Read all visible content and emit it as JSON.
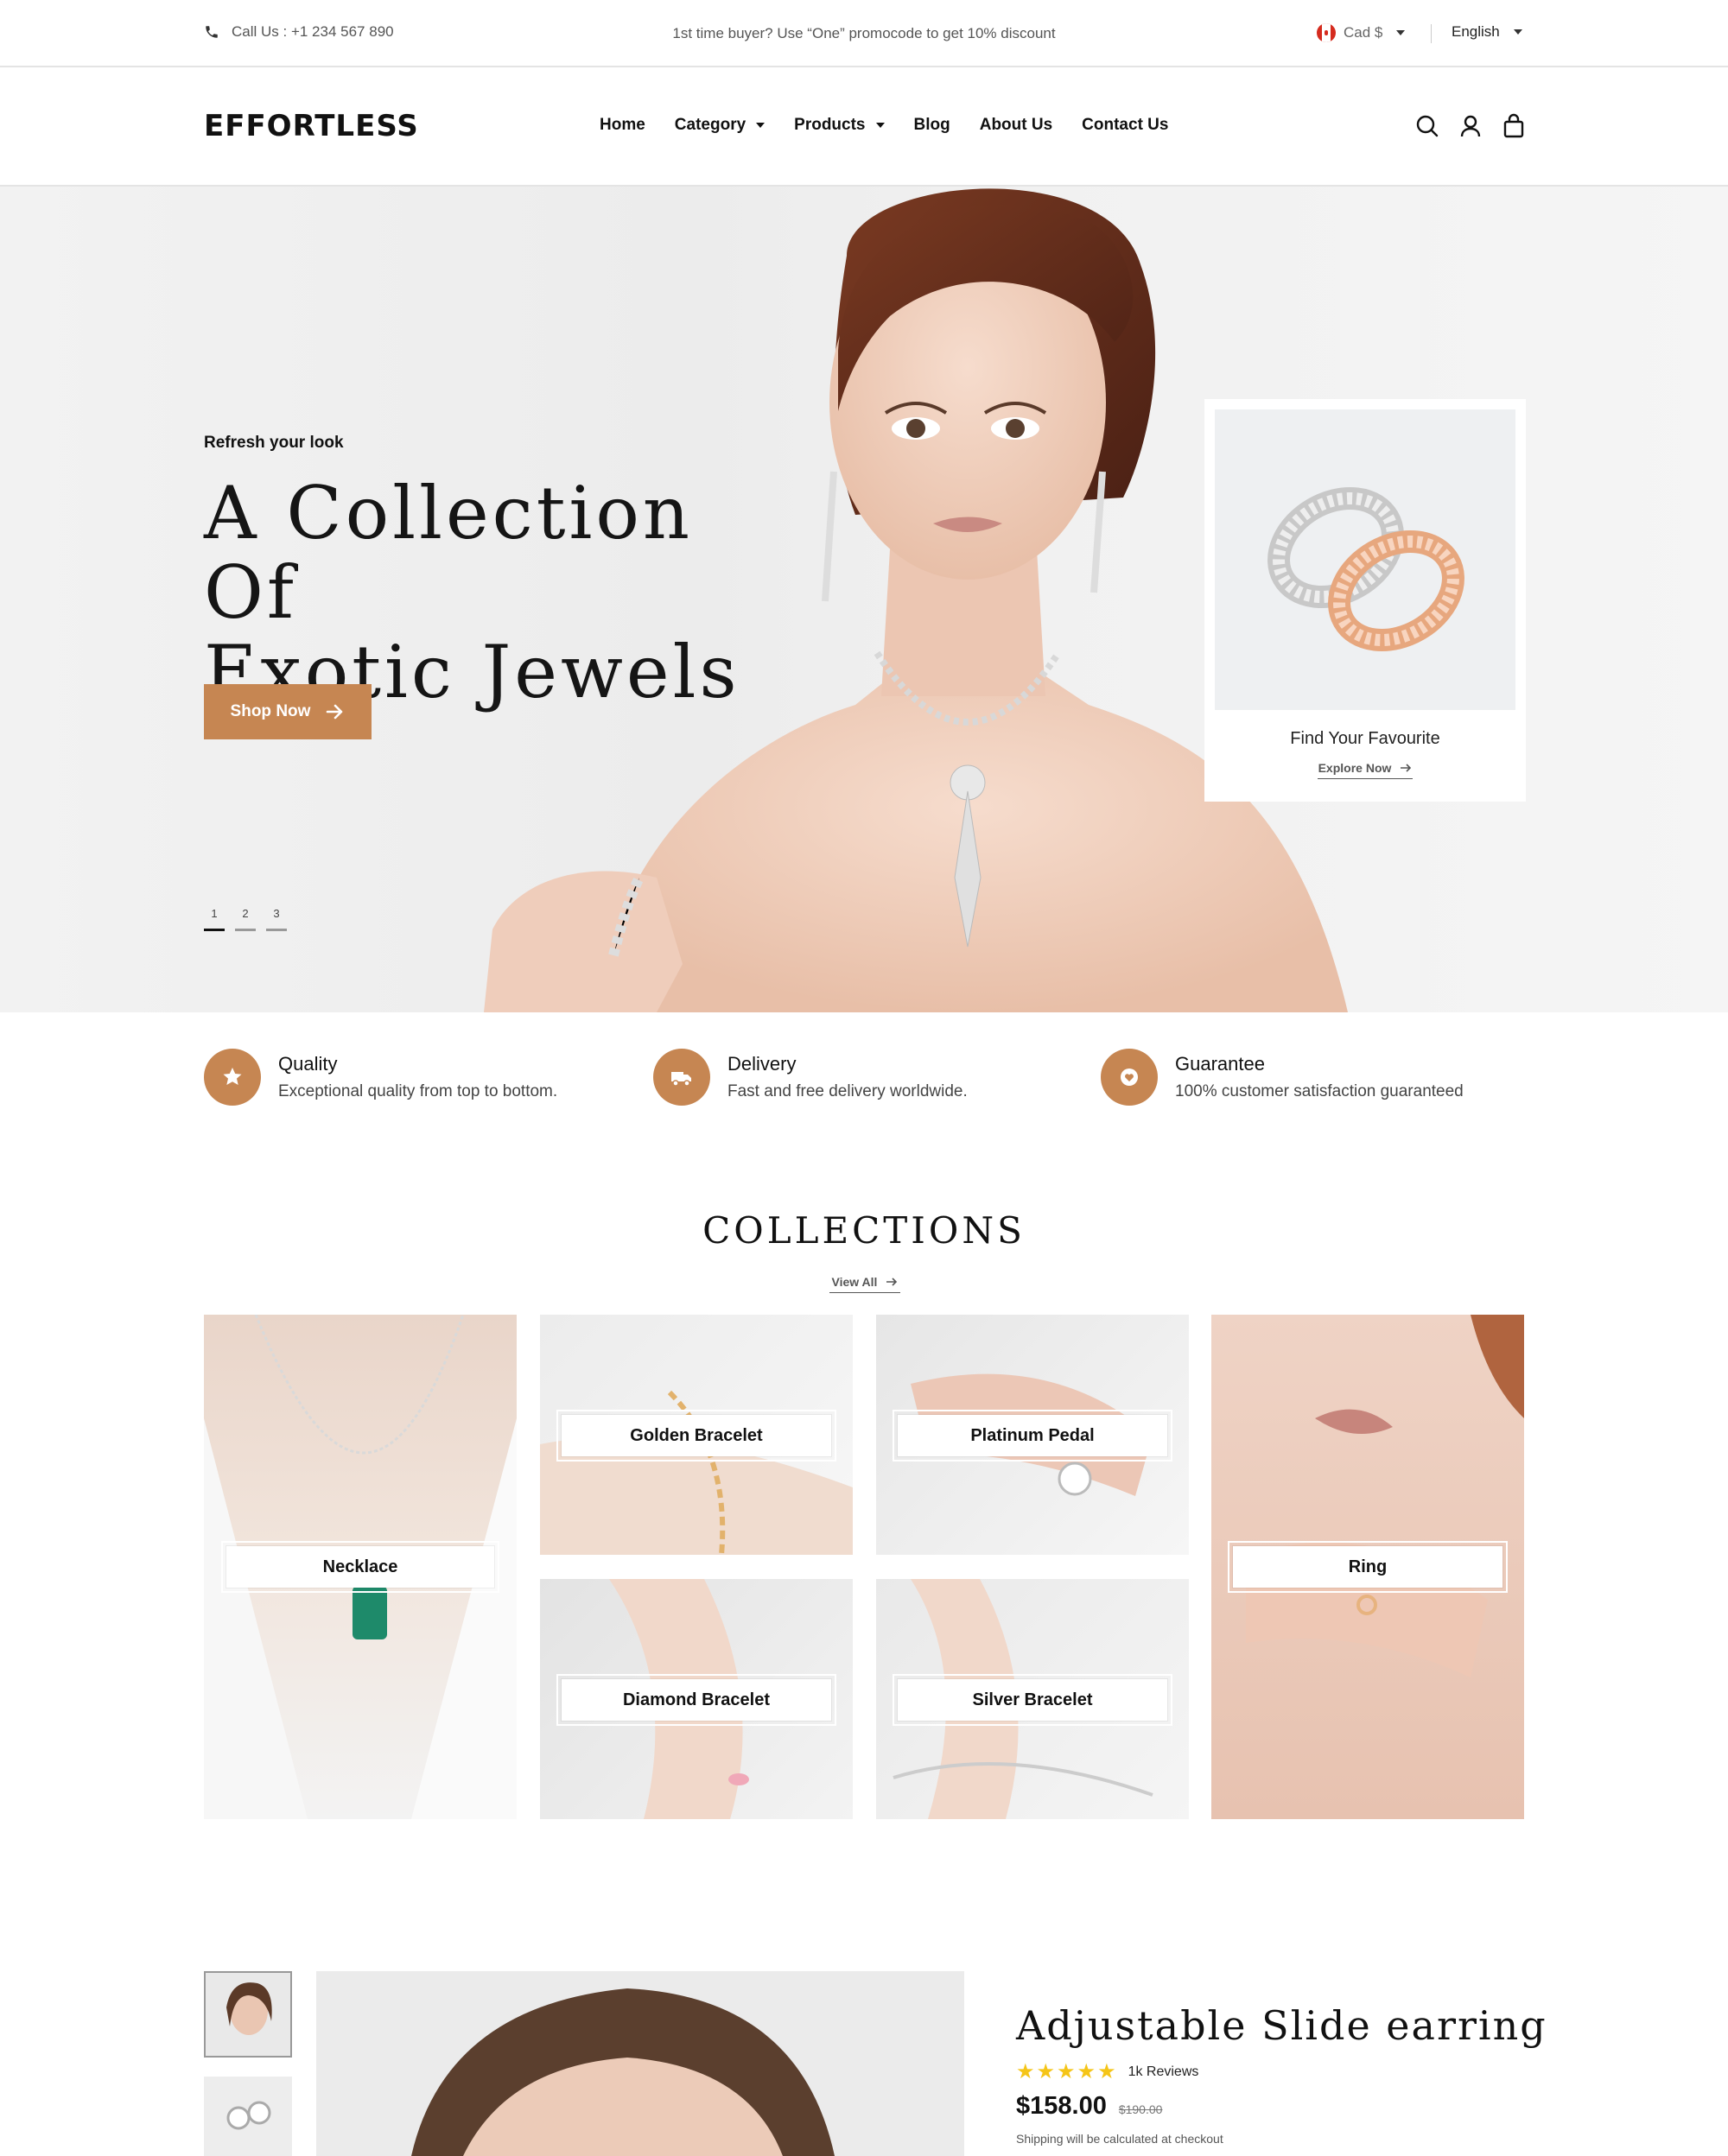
{
  "topbar": {
    "call": "Call Us : +1 234 567 890",
    "promo": "1st time buyer? Use “One” promocode to get 10% discount",
    "currency": "Cad $",
    "language": "English"
  },
  "header": {
    "logo": "EFFORTLESS",
    "nav": [
      {
        "label": "Home"
      },
      {
        "label": "Category"
      },
      {
        "label": "Products"
      },
      {
        "label": "Blog"
      },
      {
        "label": "About Us"
      },
      {
        "label": "Contact Us"
      }
    ],
    "icons": [
      "search-icon",
      "user-icon",
      "bag-icon"
    ]
  },
  "hero": {
    "subtitle": "Refresh your look",
    "title_line1": "A Collection Of",
    "title_line2": "Exotic Jewels",
    "cta": "Shop Now",
    "slides": [
      "1",
      "2",
      "3"
    ],
    "active_slide": 1,
    "card": {
      "title": "Find Your Favourite",
      "link": "Explore Now"
    }
  },
  "features": [
    {
      "title": "Quality",
      "desc": "Exceptional quality from top to bottom.",
      "icon": "star-icon"
    },
    {
      "title": "Delivery",
      "desc": "Fast and free delivery worldwide.",
      "icon": "truck-icon"
    },
    {
      "title": "Guarantee",
      "desc": "100% customer satisfaction guaranteed",
      "icon": "heart-icon"
    }
  ],
  "collections": {
    "title": "COLLECTIONS",
    "view_all": "View All",
    "items": [
      {
        "label": "Necklace"
      },
      {
        "label": "Golden Bracelet"
      },
      {
        "label": "Platinum Pedal"
      },
      {
        "label": "Ring"
      },
      {
        "label": "Diamond Bracelet"
      },
      {
        "label": "Silver Bracelet"
      }
    ]
  },
  "product": {
    "title": "Adjustable Slide earring",
    "reviews": "1k Reviews",
    "rating": 5,
    "price": "$158.00",
    "old_price": "$190.00",
    "shipping": "Shipping will be calculated at checkout"
  },
  "colors": {
    "accent": "#c68652",
    "star": "#f5c518"
  }
}
